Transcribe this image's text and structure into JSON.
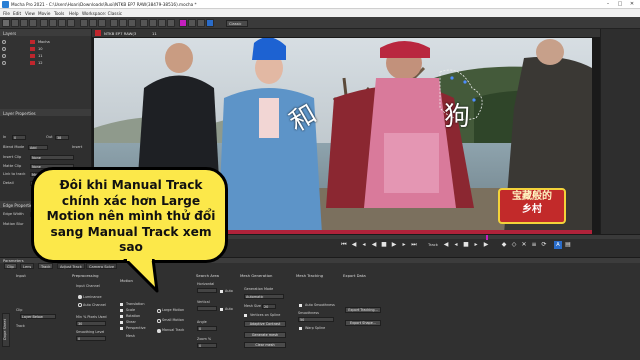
{
  "window": {
    "title": "Mocha Pro 2021 - C:\\Users\\Hoan\\Downloads\\Ruoi\\NTKB EP7 RAW(38479-38516).mocha *",
    "controls": [
      "–",
      "□",
      "✕"
    ]
  },
  "menu": [
    "File",
    "Edit",
    "View",
    "Movie",
    "Tools",
    "Help",
    "Workspace: Classic"
  ],
  "toolbar": {
    "workspace_value": "Classic",
    "accent_magenta": "#c51fbf",
    "accent_blue": "#2a6cc9"
  },
  "layers": {
    "header": "Layers",
    "rows": [
      {
        "name": "Mocha",
        "color": "#c0262d"
      },
      {
        "name": "10",
        "color": "#c0262d"
      },
      {
        "name": "11",
        "color": "#c0262d"
      },
      {
        "name": "12",
        "color": "#c0262d"
      }
    ]
  },
  "layer_properties": {
    "header": "Layer Properties",
    "in_label": "In",
    "in_value": "0",
    "out_label": "Out",
    "out_value": "38",
    "blend_mode_label": "Blend Mode",
    "blend_mode_value": "Add",
    "insert_label": "Insert",
    "insert_clip_label": "Insert Clip",
    "insert_clip_value": "None",
    "matte_clip_label": "Matte Clip",
    "matte_clip_value": "None",
    "link_track_label": "Link to track",
    "link_track_value": "Mocha",
    "detail_label": "Detail",
    "edge_header": "Edge Properties",
    "edge_width_label": "Edge Width",
    "motion_blur_label": "Motion Blur"
  },
  "viewer": {
    "clip_tab": "NTKB EP7 RAW(3",
    "frame": "11",
    "overlay_chars": [
      "和",
      "狗"
    ],
    "show_logo_line1": "宝藏般的",
    "show_logo_line2": "乡村"
  },
  "timeline": {
    "track_label": "Track",
    "accent": "#c51fbf"
  },
  "parameters": {
    "header": "Parameters",
    "tabs": [
      "Clip",
      "Lens",
      "Track",
      "Adjust Track",
      "Camera Solve"
    ],
    "side_tab": "Dope Sheet",
    "input": {
      "header": "Input",
      "clip_label": "Clip",
      "clip_value": "Layer Below",
      "track_label": "Track"
    },
    "preprocessing": {
      "header": "Preprocessing",
      "input_channel": "Input Channel",
      "luminance": "Luminance",
      "auto_channel": "Auto Channel",
      "min_pixels_label": "Min % Pixels Used",
      "min_pixels_value": "30",
      "smoothing_label": "Smoothing Level",
      "smoothing_value": "0"
    },
    "motion": {
      "header": "Motion",
      "items": [
        "Translation",
        "Scale",
        "Rotation",
        "Shear",
        "Perspective"
      ],
      "mesh_label": "Mesh"
    },
    "track_mode": {
      "large_motion": "Large Motion",
      "small_motion": "Small Motion",
      "manual_track": "Manual Track"
    },
    "search_area": {
      "header": "Search Area",
      "horizontal": "Horizontal",
      "vertical": "Vertical",
      "auto": "Auto",
      "angle_label": "Angle",
      "angle_value": "0",
      "zoom_label": "Zoom %",
      "zoom_value": "0"
    },
    "mesh_generation": {
      "header": "Mesh Generation",
      "mode_label": "Generation Mode",
      "mode_value": "Automatic",
      "mesh_size_label": "Mesh Size",
      "mesh_size_value": "20",
      "vertices_on_spline": "Vertices on Spline",
      "adaptive_contrast": "Adaptive Contrast",
      "generate_mesh": "Generate mesh",
      "clear_mesh": "Clear mesh"
    },
    "mesh_tracking": {
      "header": "Mesh Tracking",
      "auto_smoothness": "Auto Smoothness",
      "smoothness_label": "Smoothness",
      "smoothness_value": "50",
      "warp_spline": "Warp Spline"
    },
    "export_data": {
      "header": "Export Data",
      "export_tracking": "Export Tracking...",
      "export_shape": "Export Shape..."
    }
  },
  "callout": {
    "text": "Đôi khi Manual Track chính xác hơn Large Motion nên mình thử đổi sang Manual Track xem sao",
    "background": "#fce84a"
  }
}
